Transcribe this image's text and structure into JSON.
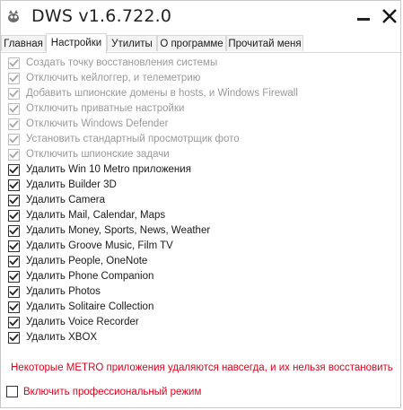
{
  "window": {
    "title": "DWS v1.6.722.0"
  },
  "tabs": [
    {
      "label": "Главная",
      "active": false
    },
    {
      "label": "Настройки",
      "active": true
    },
    {
      "label": "Утилиты",
      "active": false
    },
    {
      "label": "О программе",
      "active": false
    },
    {
      "label": "Прочитай меня",
      "active": false
    }
  ],
  "options": [
    {
      "label": "Создать точку восстановления системы",
      "checked": true,
      "enabled": false
    },
    {
      "label": "Отключить кейлоггер, и телеметрию",
      "checked": true,
      "enabled": false
    },
    {
      "label": "Добавить шпионские домены в hosts, и Windows Firewall",
      "checked": true,
      "enabled": false
    },
    {
      "label": "Отключить приватные настройки",
      "checked": true,
      "enabled": false
    },
    {
      "label": "Отключить Windows Defender",
      "checked": true,
      "enabled": false
    },
    {
      "label": "Установить стандартный просмотрщик фото",
      "checked": true,
      "enabled": false
    },
    {
      "label": "Отключить шпионские задачи",
      "checked": true,
      "enabled": false
    },
    {
      "label": "Удалить Win 10 Metro приложения",
      "checked": true,
      "enabled": true
    },
    {
      "label": "Удалить Builder 3D",
      "checked": true,
      "enabled": true
    },
    {
      "label": "Удалить Camera",
      "checked": true,
      "enabled": true
    },
    {
      "label": "Удалить Mail, Calendar, Maps",
      "checked": true,
      "enabled": true
    },
    {
      "label": "Удалить Money, Sports, News, Weather",
      "checked": true,
      "enabled": true
    },
    {
      "label": "Удалить Groove Music, Film TV",
      "checked": true,
      "enabled": true
    },
    {
      "label": "Удалить People, OneNote",
      "checked": true,
      "enabled": true
    },
    {
      "label": "Удалить Phone Companion",
      "checked": true,
      "enabled": true
    },
    {
      "label": "Удалить Photos",
      "checked": true,
      "enabled": true
    },
    {
      "label": "Удалить Solitaire Collection",
      "checked": true,
      "enabled": true
    },
    {
      "label": "Удалить Voice Recorder",
      "checked": true,
      "enabled": true
    },
    {
      "label": "Удалить XBOX",
      "checked": true,
      "enabled": true
    }
  ],
  "warning": "Некоторые METRO приложения удаляются навсегда, и их нельзя восстановить",
  "pro_mode": {
    "label": "Включить профессиональный режим",
    "checked": false
  },
  "colors": {
    "warning": "#e0001b",
    "disabled_text": "#9a9a9a",
    "check_enabled": "#222222",
    "check_disabled": "#a6a6a6"
  },
  "icons": {
    "app": "gimp-like-app-icon",
    "minimize": "minimize-icon",
    "close": "close-icon",
    "check": "check-icon"
  }
}
